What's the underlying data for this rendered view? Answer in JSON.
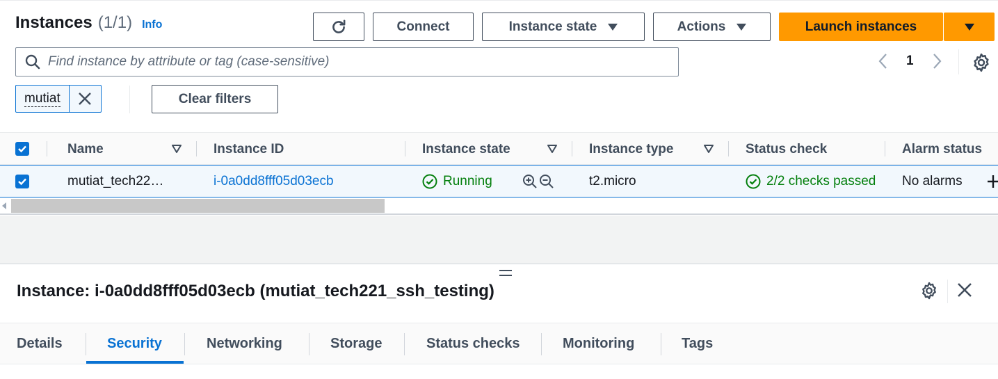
{
  "header": {
    "title": "Instances",
    "count": "(1/1)",
    "info_label": "Info"
  },
  "toolbar": {
    "connect_label": "Connect",
    "instance_state_label": "Instance state",
    "actions_label": "Actions",
    "launch_label": "Launch instances"
  },
  "search": {
    "placeholder": "Find instance by attribute or tag (case-sensitive)"
  },
  "pagination": {
    "current_page": "1"
  },
  "filter": {
    "token_label": "mutiat",
    "clear_label": "Clear filters"
  },
  "table": {
    "columns": [
      "Name",
      "Instance ID",
      "Instance state",
      "Instance type",
      "Status check",
      "Alarm status"
    ],
    "rows": [
      {
        "name": "mutiat_tech22…",
        "instance_id": "i-0a0dd8fff05d03ecb",
        "state": "Running",
        "type": "t2.micro",
        "status_check": "2/2 checks passed",
        "alarm_status": "No alarms"
      }
    ]
  },
  "detail": {
    "title": "Instance: i-0a0dd8fff05d03ecb (mutiat_tech221_ssh_testing)",
    "tabs": [
      "Details",
      "Security",
      "Networking",
      "Storage",
      "Status checks",
      "Monitoring",
      "Tags"
    ],
    "active_tab": "Security"
  },
  "colors": {
    "accent": "#0972d3",
    "launch": "#ff9900",
    "success": "#037f0c"
  }
}
